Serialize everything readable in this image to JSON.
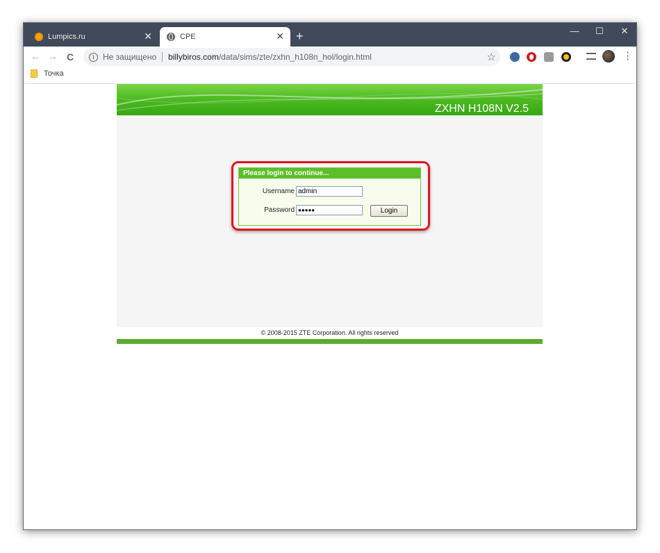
{
  "browser": {
    "tabs": [
      {
        "title": "Lumpics.ru",
        "active": false,
        "favicon": "lumpics-favicon"
      },
      {
        "title": "CPE",
        "active": true,
        "favicon": "globe-icon"
      }
    ],
    "new_tab_glyph": "+",
    "close_glyph": "✕",
    "window_controls": {
      "minimize": "—",
      "maximize": "☐",
      "close": "✕"
    },
    "nav": {
      "back": "←",
      "forward": "→",
      "reload": "C"
    },
    "address": {
      "security_text": "Не защищено",
      "domain": "billybiros.com",
      "path": "/data/sims/zte/zxhn_h108n_hol/login.html"
    },
    "bookmarks": [
      {
        "label": "Точка"
      }
    ],
    "menu_glyph": "⋮",
    "star_glyph": "☆"
  },
  "router_page": {
    "model": "ZXHN H108N V2.5",
    "login": {
      "title": "Please login to continue...",
      "username_label": "Username",
      "username_value": "admin",
      "password_label": "Password",
      "password_value": "●●●●●",
      "button_label": "Login"
    },
    "footer": "© 2008-2015 ZTE Corporation. All rights reserved"
  },
  "colors": {
    "highlight": "#e0141c",
    "router_green": "#5cbf2a",
    "titlebar": "#414a5a"
  }
}
